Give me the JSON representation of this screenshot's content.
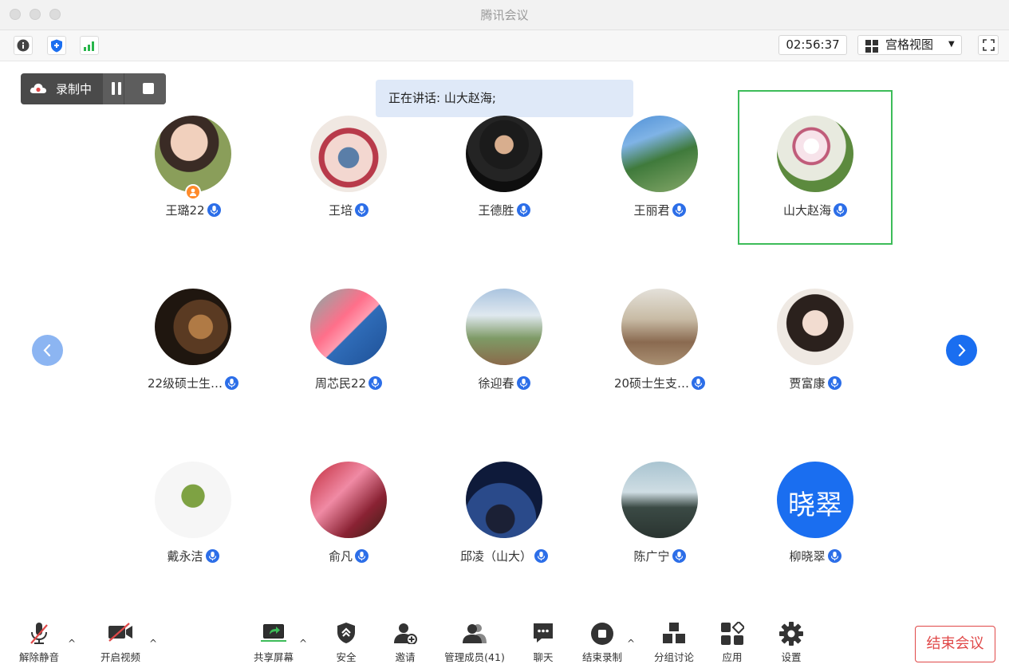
{
  "window": {
    "title": "腾讯会议"
  },
  "toolbar": {
    "timer": "02:56:37",
    "view_label": "宫格视图"
  },
  "recording": {
    "label": "录制中"
  },
  "speaking": {
    "text": "正在讲话: 山大赵海;"
  },
  "participants": [
    {
      "name": "王璐22"
    },
    {
      "name": "王培"
    },
    {
      "name": "王德胜"
    },
    {
      "name": "王丽君"
    },
    {
      "name": "山大赵海"
    },
    {
      "name": "22级硕士生…"
    },
    {
      "name": "周芯民22"
    },
    {
      "name": "徐迎春"
    },
    {
      "name": "20硕士生支…"
    },
    {
      "name": "贾富康"
    },
    {
      "name": "戴永洁"
    },
    {
      "name": "俞凡"
    },
    {
      "name": "邱凌（山大）"
    },
    {
      "name": "陈广宁"
    },
    {
      "name": "柳晓翠",
      "avatar_text": "晓翠"
    }
  ],
  "bottom": {
    "unmute": "解除静音",
    "video": "开启视频",
    "share": "共享屏幕",
    "security": "安全",
    "invite": "邀请",
    "members": "管理成员(41)",
    "chat": "聊天",
    "stop_record": "结束录制",
    "breakout": "分组讨论",
    "apps": "应用",
    "settings": "设置",
    "end": "结束会议"
  },
  "colors": {
    "accent": "#1a6ef0",
    "active_border": "#3dbc59",
    "end_red": "#e04848"
  }
}
